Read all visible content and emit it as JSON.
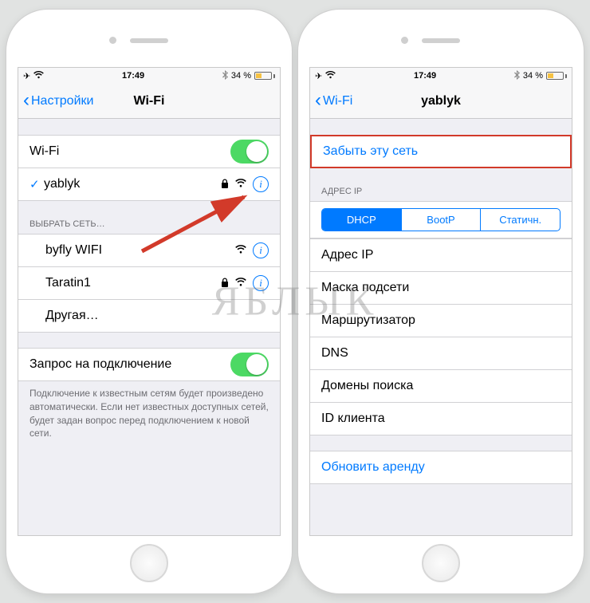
{
  "status": {
    "time": "17:49",
    "battery_pct": "34 %",
    "airplane": "✈︎",
    "wifi": "✓",
    "bt": "✱"
  },
  "left": {
    "nav": {
      "back": "Настройки",
      "title": "Wi-Fi"
    },
    "wifi_toggle_label": "Wi-Fi",
    "connected": {
      "name": "yablyk",
      "secured": true
    },
    "choose_header": "ВЫБРАТЬ СЕТЬ…",
    "networks": [
      {
        "name": "byfly WIFI",
        "secured": false
      },
      {
        "name": "Taratin1",
        "secured": true
      }
    ],
    "other_label": "Другая…",
    "ask_join_label": "Запрос на подключение",
    "footer": "Подключение к известным сетям будет произведено автоматически. Если нет известных доступных сетей, будет задан вопрос перед подключением к новой сети."
  },
  "right": {
    "nav": {
      "back": "Wi-Fi",
      "title": "yablyk"
    },
    "forget_label": "Забыть эту сеть",
    "ip_header": "АДРЕС IP",
    "segments": {
      "dhcp": "DHCP",
      "bootp": "BootP",
      "static": "Статичн."
    },
    "fields": {
      "ip": "Адрес IP",
      "mask": "Маска подсети",
      "router": "Маршрутизатор",
      "dns": "DNS",
      "search": "Домены поиска",
      "client": "ID клиента"
    },
    "renew_label": "Обновить аренду"
  },
  "watermark": "ЯБЛЫК"
}
